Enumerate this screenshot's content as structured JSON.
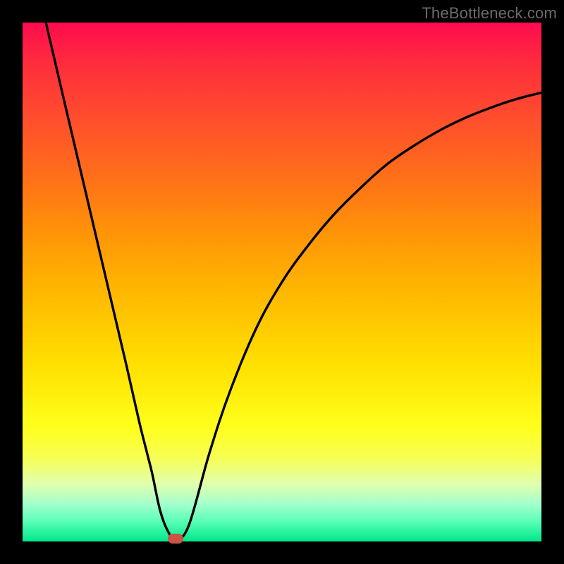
{
  "attribution": "TheBottleneck.com",
  "chart_data": {
    "type": "line",
    "title": "",
    "xlabel": "",
    "ylabel": "",
    "xlim": [
      0,
      100
    ],
    "ylim": [
      0,
      100
    ],
    "series": [
      {
        "name": "curve",
        "x": [
          4.5,
          8,
          12,
          16,
          20,
          22.5,
          24,
          25,
          26.5,
          28,
          29.5,
          32,
          36,
          40,
          45,
          50,
          55,
          60,
          65,
          70,
          75,
          80,
          85,
          90,
          95,
          100
        ],
        "y": [
          100,
          85,
          68,
          51,
          34,
          23,
          17,
          13,
          6,
          2,
          0.5,
          3,
          17,
          29,
          41,
          50,
          57,
          63,
          68,
          72.5,
          76,
          79,
          81.5,
          83.5,
          85.2,
          86.5
        ]
      }
    ],
    "minimum_marker": {
      "x": 29.5,
      "y": 0.5
    },
    "grid": false,
    "legend": false
  }
}
